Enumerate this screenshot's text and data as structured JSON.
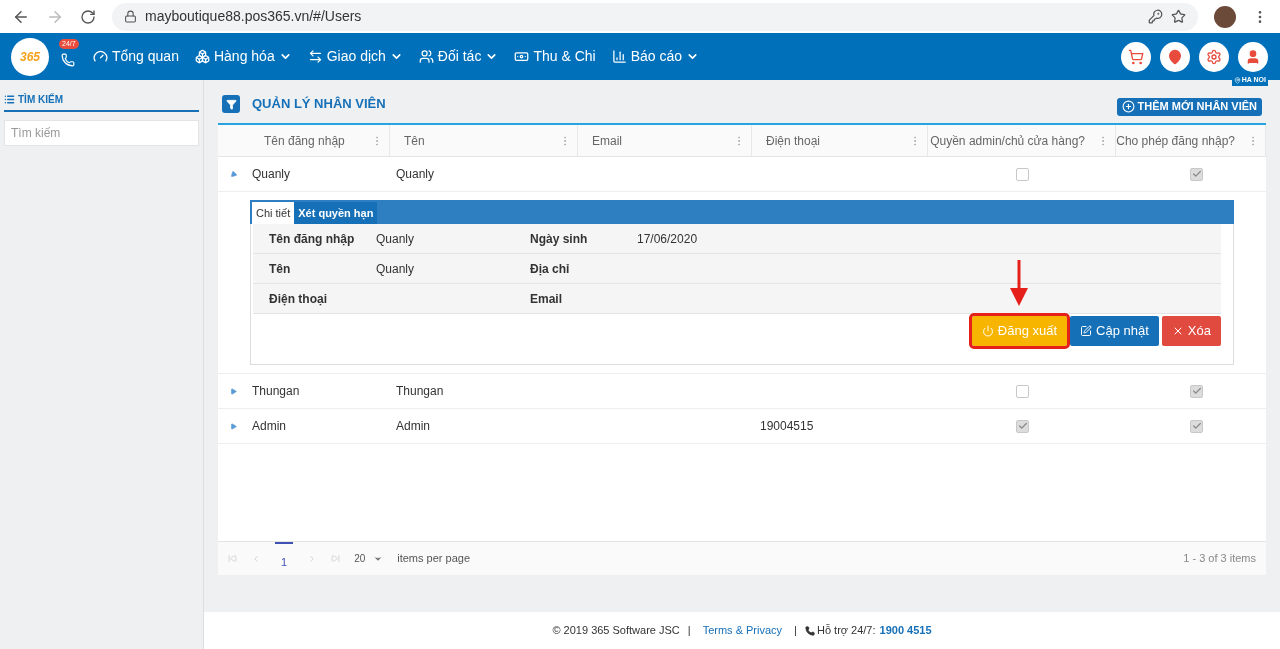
{
  "browser": {
    "url": "mayboutique88.pos365.vn/#/Users"
  },
  "nav": {
    "logo": "365",
    "hotline_badge": "24/7",
    "items": [
      {
        "label": "Tổng quan",
        "kind": "dashboard",
        "dropdown": false
      },
      {
        "label": "Hàng hóa",
        "kind": "goods",
        "dropdown": true
      },
      {
        "label": "Giao dịch",
        "kind": "transactions",
        "dropdown": true
      },
      {
        "label": "Đối tác",
        "kind": "partners",
        "dropdown": true
      },
      {
        "label": "Thu & Chi",
        "kind": "money",
        "dropdown": false
      },
      {
        "label": "Báo cáo",
        "kind": "reports",
        "dropdown": true
      }
    ],
    "actions": [
      {
        "kind": "cart"
      },
      {
        "kind": "location"
      },
      {
        "kind": "settings"
      },
      {
        "kind": "user"
      }
    ],
    "branch": "HA NOI"
  },
  "sidebar": {
    "title": "TÌM KIẾM",
    "search": {
      "placeholder": "Tìm kiếm"
    }
  },
  "page": {
    "title": "QUẢN LÝ NHÂN VIÊN",
    "add_button": "THÊM MỚI NHÂN VIÊN"
  },
  "table": {
    "columns": [
      "Tên đăng nhập",
      "Tên",
      "Email",
      "Điện thoại",
      "Quyền admin/chủ cửa hàng?",
      "Cho phép đăng nhập?"
    ],
    "rows": [
      {
        "username": "Quanly",
        "name": "Quanly",
        "admin": false,
        "allow_login": true,
        "expanded": true
      },
      {
        "username": "Thungan",
        "name": "Thungan",
        "admin": false,
        "allow_login": true,
        "expanded": false
      },
      {
        "username": "Admin",
        "name": "Admin",
        "phone": "19004515",
        "admin": true,
        "allow_login": true,
        "expanded": false
      }
    ]
  },
  "detail": {
    "tabs": [
      {
        "label": "Chi tiết",
        "selected": true
      },
      {
        "label": "Xét quyền hạn",
        "selected": false
      }
    ],
    "fields": [
      {
        "label": "Tên đăng nhập",
        "value": "Quanly",
        "label2": "Ngày sinh",
        "value2": "17/06/2020"
      },
      {
        "label": "Tên",
        "value": "Quanly",
        "label2": "Địa chỉ"
      },
      {
        "label": "Điện thoại",
        "label2": "Email"
      }
    ],
    "buttons": [
      {
        "label": "Đăng xuất",
        "kind": "logout",
        "highlighted": true
      },
      {
        "label": "Cập nhật",
        "kind": "update",
        "highlighted": false
      },
      {
        "label": "Xóa",
        "kind": "delete",
        "highlighted": false
      }
    ]
  },
  "pager": {
    "pages": [
      {
        "label": "1",
        "selected": true
      }
    ],
    "page_size": "20",
    "page_size_label": "items per page",
    "summary": "1 - 3 of 3 items"
  },
  "footer": {
    "copyright": "© 2019 365 Software JSC",
    "separators": [
      "|",
      "|"
    ],
    "link": "Terms & Privacy",
    "support_label": "Hỗ trợ 24/7:",
    "support_phone": "1900 4515"
  }
}
